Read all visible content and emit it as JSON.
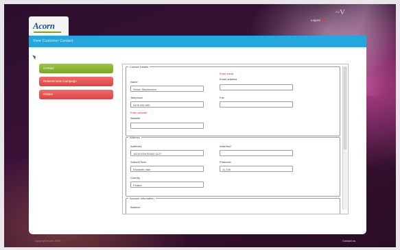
{
  "app": {
    "logo_text": "Acorn",
    "brand_mark": "~V",
    "logout_label": "Logout"
  },
  "page": {
    "title": "View Customer Contact"
  },
  "nav": [
    {
      "label": "Contact",
      "state": "active"
    },
    {
      "label": "Reserve New Campaign",
      "state": "normal"
    },
    {
      "label": "Orders",
      "state": "normal"
    }
  ],
  "sections": {
    "contact": {
      "legend": "Contact Details",
      "name_label": "Name",
      "name_value": "Simon Stephenson",
      "telephone_label": "Telephone",
      "telephone_value": "0478 432 630",
      "website_warning": "Enter website",
      "website_label": "Website",
      "website_value": "",
      "email_warning": "Enter email",
      "email_label": "Email address",
      "email_value": "",
      "fax_label": "Fax",
      "fax_value": ""
    },
    "address": {
      "legend": "Address",
      "address1_label": "Address1",
      "address1_value": "JACKSON ROAD 1127",
      "address2_label": "Address2",
      "address2_value": "",
      "suburb_label": "Suburb/Town",
      "suburb_value": "Elizabeth Vale",
      "postcode_label": "Postcode",
      "postcode_value": "11-100",
      "country_label": "Country",
      "country_value": "Poland"
    },
    "account": {
      "legend": "Account Information",
      "first_label": "Balance"
    }
  },
  "footer": {
    "copyright": "Copyright Acorn 2009",
    "contact_link": "Contact us"
  },
  "colors": {
    "titlebar": "#24a7dd",
    "nav_active": "#8bb833",
    "nav_normal": "#e35757",
    "warning": "#d82a2a"
  }
}
